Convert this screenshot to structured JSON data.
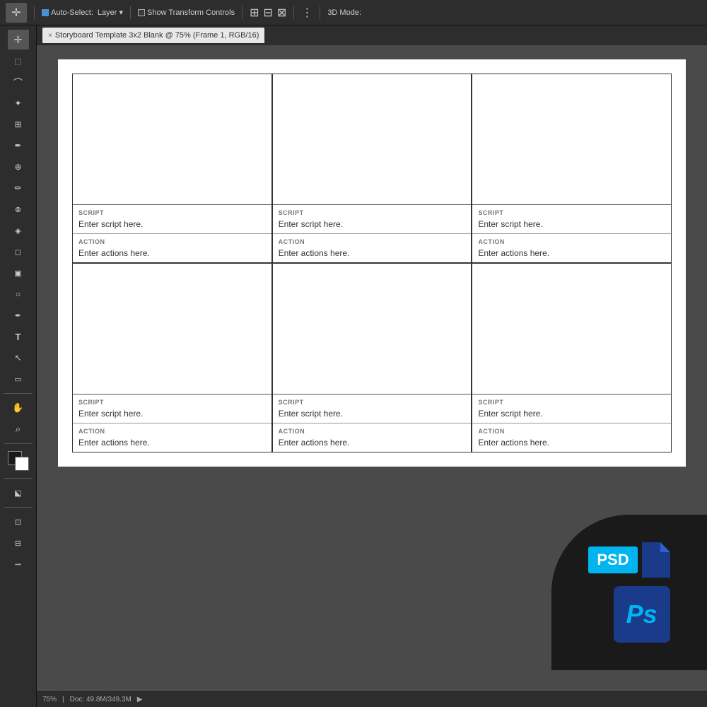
{
  "toolbar": {
    "auto_select_label": "Auto-Select:",
    "layer_label": "Layer",
    "show_transform_label": "Show Transform Controls",
    "mode_label": "3D Mode:"
  },
  "tab": {
    "close_icon": "×",
    "title": "Storyboard Template 3x2 Blank @ 75% (Frame 1, RGB/16)"
  },
  "cells": [
    {
      "script_label": "SCRIPT",
      "script_text": "Enter script here.",
      "action_label": "ACTION",
      "action_text": "Enter actions here."
    },
    {
      "script_label": "SCRIPT",
      "script_text": "Enter script here.",
      "action_label": "ACTION",
      "action_text": "Enter actions here."
    },
    {
      "script_label": "SCRIPT",
      "script_text": "Enter script here.",
      "action_label": "ACTION",
      "action_text": "Enter actions here."
    },
    {
      "script_label": "SCRIPT",
      "script_text": "Enter script here.",
      "action_label": "ACTION",
      "action_text": "Enter actions here."
    },
    {
      "script_label": "SCRIPT",
      "script_text": "Enter script here.",
      "action_label": "ACTION",
      "action_text": "Enter actions here."
    },
    {
      "script_label": "SCRIPT",
      "script_text": "Enter script here.",
      "action_label": "ACTION",
      "action_text": "Enter actions here."
    }
  ],
  "status_bar": {
    "zoom": "75%",
    "doc_info": "Doc: 49.8M/349.3M"
  },
  "tools": [
    {
      "name": "move",
      "icon": "✛"
    },
    {
      "name": "selection",
      "icon": "⬚"
    },
    {
      "name": "lasso",
      "icon": "⌒"
    },
    {
      "name": "wand",
      "icon": "✦"
    },
    {
      "name": "crop",
      "icon": "⊞"
    },
    {
      "name": "eyedropper",
      "icon": "✒"
    },
    {
      "name": "heal",
      "icon": "⊕"
    },
    {
      "name": "brush",
      "icon": "✏"
    },
    {
      "name": "clone",
      "icon": "⊗"
    },
    {
      "name": "history",
      "icon": "◈"
    },
    {
      "name": "eraser",
      "icon": "◻"
    },
    {
      "name": "gradient",
      "icon": "▣"
    },
    {
      "name": "dodge",
      "icon": "○"
    },
    {
      "name": "pen",
      "icon": "✒"
    },
    {
      "name": "text",
      "icon": "T"
    },
    {
      "name": "pointer",
      "icon": "↖"
    },
    {
      "name": "shape",
      "icon": "▭"
    },
    {
      "name": "hand",
      "icon": "✋"
    },
    {
      "name": "zoom",
      "icon": "⌕"
    }
  ],
  "psd": {
    "badge_text": "PSD",
    "ps_text": "Ps"
  }
}
